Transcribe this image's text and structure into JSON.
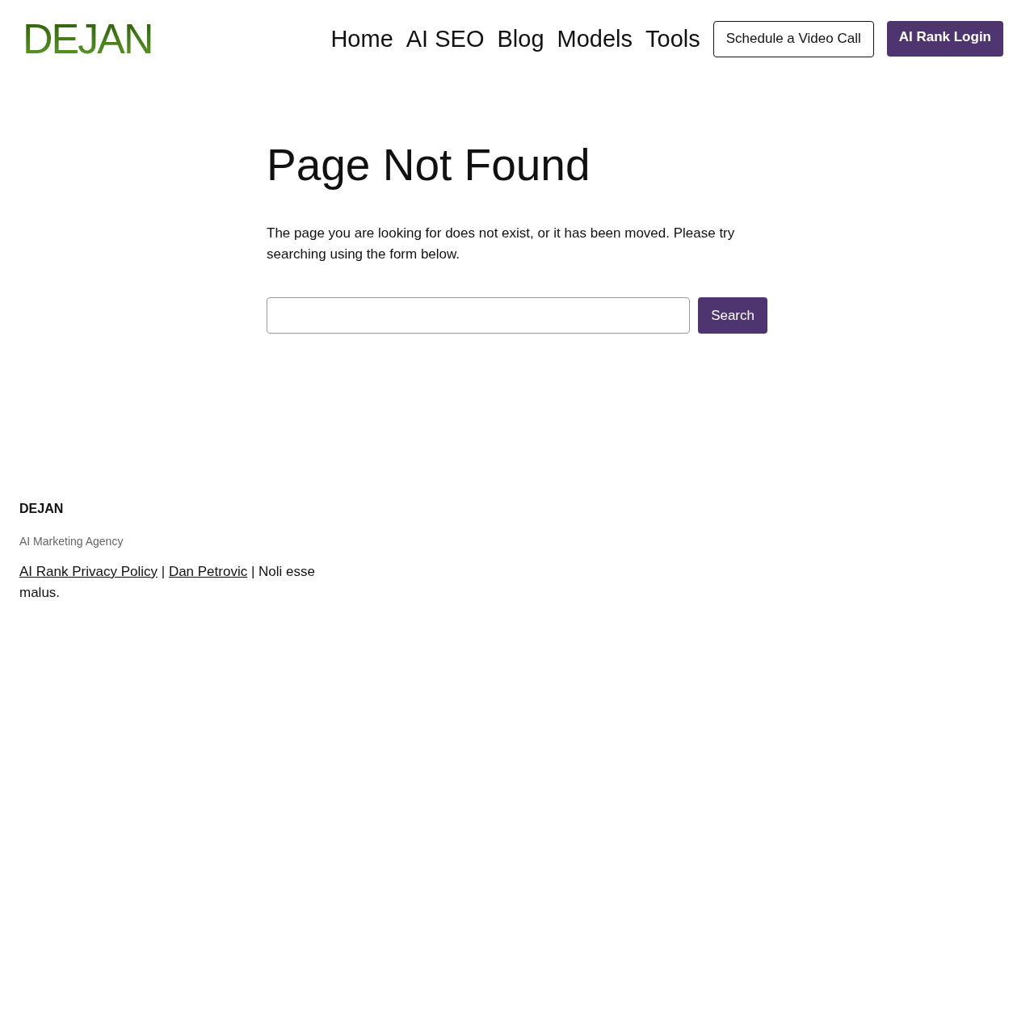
{
  "header": {
    "logo": "DEJAN",
    "nav": [
      "Home",
      "AI SEO",
      "Blog",
      "Models",
      "Tools"
    ],
    "buttons": [
      {
        "label": "Schedule a Video Call",
        "kind": "outline"
      },
      {
        "label": "AI Rank Login",
        "kind": "primary"
      }
    ]
  },
  "main": {
    "title": "Page Not Found",
    "message": "The page you are looking for does not exist, or it has been moved. Please try searching using the form below.",
    "search_button": "Search"
  },
  "footer": {
    "brand": "DEJAN",
    "tagline": "AI Marketing Agency",
    "line": [
      {
        "kind": "link",
        "text": "AI Rank Privacy Policy"
      },
      {
        "kind": "text",
        "text": " | "
      },
      {
        "kind": "link",
        "text": "Dan Petrovic"
      },
      {
        "kind": "text",
        "text": " | Noli esse malus."
      }
    ]
  }
}
